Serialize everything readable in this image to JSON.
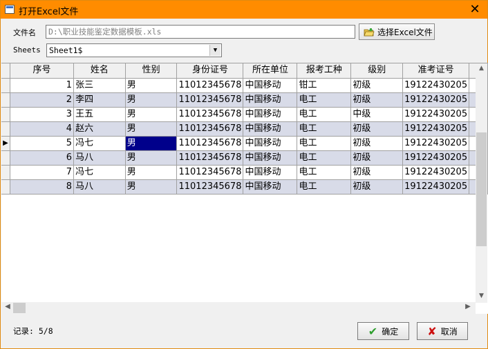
{
  "window": {
    "title": "打开Excel文件",
    "close_glyph": "✕"
  },
  "form": {
    "file_label": "文件名",
    "file_value": "D:\\职业技能鉴定数据模板.xls",
    "pick_button": "选择Excel文件",
    "sheets_label": "Sheets",
    "sheet_value": "Sheet1$",
    "dropdown_glyph": "▼"
  },
  "grid": {
    "columns": [
      "序号",
      "姓名",
      "性别",
      "身份证号",
      "所在单位",
      "报考工种",
      "级别",
      "准考证号"
    ],
    "rows": [
      [
        "1",
        "张三",
        "男",
        "11012345678",
        "中国移动",
        "钳工",
        "初级",
        "19122430205"
      ],
      [
        "2",
        "李四",
        "男",
        "11012345678",
        "中国移动",
        "电工",
        "初级",
        "19122430205"
      ],
      [
        "3",
        "王五",
        "男",
        "11012345678",
        "中国移动",
        "电工",
        "中级",
        "19122430205"
      ],
      [
        "4",
        "赵六",
        "男",
        "11012345678",
        "中国移动",
        "电工",
        "初级",
        "19122430205"
      ],
      [
        "5",
        "冯七",
        "男",
        "11012345678",
        "中国移动",
        "电工",
        "初级",
        "19122430205"
      ],
      [
        "6",
        "马八",
        "男",
        "11012345678",
        "中国移动",
        "电工",
        "初级",
        "19122430205"
      ],
      [
        "7",
        "冯七",
        "男",
        "11012345678",
        "中国移动",
        "电工",
        "初级",
        "19122430205"
      ],
      [
        "8",
        "马八",
        "男",
        "11012345678",
        "中国移动",
        "电工",
        "初级",
        "19122430205"
      ]
    ],
    "current_row_marker": "▶",
    "scroll_up": "▲",
    "scroll_down": "▼",
    "scroll_left": "◀",
    "scroll_right": "▶"
  },
  "footer": {
    "record_status": "记录: 5/8",
    "ok_label": "确定",
    "ok_icon": "✔",
    "cancel_label": "取消",
    "cancel_icon": "✘"
  },
  "colors": {
    "title_bar": "#ff8c00",
    "alt_row": "#d8dbe8",
    "selected_cell": "#00008b",
    "ok_icon": "#2e9e2e",
    "cancel_icon": "#cc1010"
  }
}
